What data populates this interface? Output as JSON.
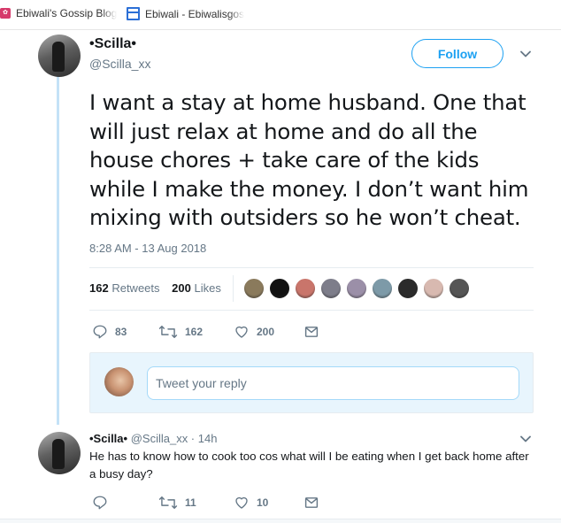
{
  "bookmarks": [
    {
      "label": "Ebiwali's Gossip Blog:",
      "icon": "pink-favicon"
    },
    {
      "label": "Ebiwali - Ebiwalisgos",
      "icon": "blue-page-favicon"
    }
  ],
  "tweet": {
    "display_name": "•Scilla•",
    "handle": "@Scilla_xx",
    "follow_label": "Follow",
    "text": "I want a stay at home husband. One that will just relax at home and do all the house chores + take care of the kids while I make the money. I don’t want him mixing with outsiders so he won’t cheat.",
    "timestamp": "8:28 AM - 13 Aug 2018",
    "retweets_count": "162",
    "retweets_label": "Retweets",
    "likes_count": "200",
    "likes_label": "Likes",
    "liker_colors": [
      "#8a7a5c",
      "#111111",
      "#c9756b",
      "#7d7d8a",
      "#9b8fa8",
      "#7d9aa8",
      "#2b2b2b",
      "#d8b9b0",
      "#555555"
    ],
    "actions": {
      "replies": "83",
      "retweets": "162",
      "likes": "200"
    }
  },
  "composer": {
    "placeholder": "Tweet your reply"
  },
  "reply": {
    "display_name": "•Scilla•",
    "meta": "@Scilla_xx · 14h",
    "text": "He has to know how to cook too cos what will I be eating when I get back home after a busy day?",
    "actions": {
      "replies": "",
      "retweets": "11",
      "likes": "10"
    }
  },
  "colors": {
    "accent": "#1da1f2",
    "muted": "#657786",
    "thread_line": "#c4e2f7",
    "composer_bg": "#e8f5fd"
  }
}
